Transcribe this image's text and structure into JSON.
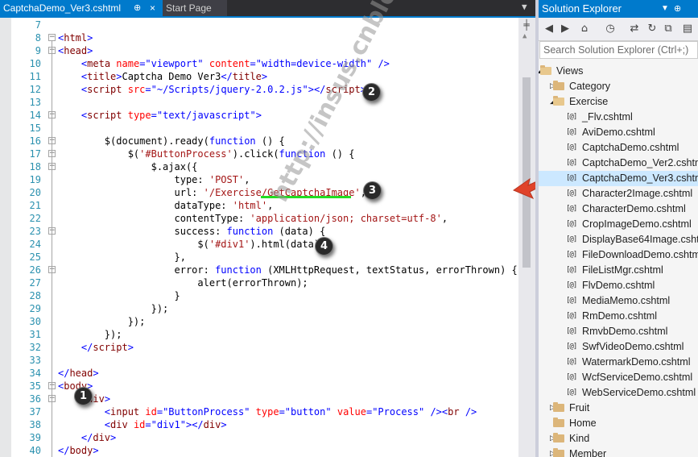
{
  "tabs": {
    "active": "CaptchaDemo_Ver3.cshtml",
    "active_pin": "⊕",
    "active_close": "×",
    "second": "Start Page"
  },
  "code_lines": [
    {
      "n": "7",
      "fold": "",
      "html": ""
    },
    {
      "n": "8",
      "fold": "−",
      "html": "<span class='tk-val'>&lt;</span><span class='tk-tag'>html</span><span class='tk-val'>&gt;</span>"
    },
    {
      "n": "9",
      "fold": "−",
      "html": "<span class='tk-val'>&lt;</span><span class='tk-tag'>head</span><span class='tk-val'>&gt;</span>"
    },
    {
      "n": "10",
      "fold": "",
      "html": "    <span class='tk-val'>&lt;</span><span class='tk-tag'>meta</span> <span class='tk-attr'>name</span><span class='tk-val'>=\"viewport\"</span> <span class='tk-attr'>content</span><span class='tk-val'>=\"width=device-width\"</span> <span class='tk-val'>/&gt;</span>"
    },
    {
      "n": "11",
      "fold": "",
      "html": "    <span class='tk-val'>&lt;</span><span class='tk-tag'>title</span><span class='tk-val'>&gt;</span>Captcha Demo Ver3<span class='tk-val'>&lt;/</span><span class='tk-tag'>title</span><span class='tk-val'>&gt;</span>"
    },
    {
      "n": "12",
      "fold": "",
      "html": "    <span class='tk-val'>&lt;</span><span class='tk-tag'>script</span> <span class='tk-attr'>src</span><span class='tk-val'>=\"~/Scripts/jquery-2.0.2.js\"</span><span class='tk-val'>&gt;&lt;/</span><span class='tk-tag'>script</span><span class='tk-val'>&gt;</span>"
    },
    {
      "n": "13",
      "fold": "",
      "html": ""
    },
    {
      "n": "14",
      "fold": "−",
      "html": "    <span class='tk-val'>&lt;</span><span class='tk-tag'>script</span> <span class='tk-attr'>type</span><span class='tk-val'>=\"text/javascript\"</span><span class='tk-val'>&gt;</span>"
    },
    {
      "n": "15",
      "fold": "",
      "html": ""
    },
    {
      "n": "16",
      "fold": "−",
      "html": "        $(document).ready(<span class='tk-kw'>function</span> () {"
    },
    {
      "n": "17",
      "fold": "−",
      "html": "            $(<span class='tk-str'>'#ButtonProcess'</span>).click(<span class='tk-kw'>function</span> () {"
    },
    {
      "n": "18",
      "fold": "−",
      "html": "                $.ajax({"
    },
    {
      "n": "19",
      "fold": "",
      "html": "                    type: <span class='tk-str'>'POST'</span>,"
    },
    {
      "n": "20",
      "fold": "",
      "html": "                    url: <span class='tk-str'>'/Exercise/GetCaptchaImage'</span>,"
    },
    {
      "n": "21",
      "fold": "",
      "html": "                    dataType: <span class='tk-str'>'html'</span>,"
    },
    {
      "n": "22",
      "fold": "",
      "html": "                    contentType: <span class='tk-str'>'application/json; charset=utf-8'</span>,"
    },
    {
      "n": "23",
      "fold": "−",
      "html": "                    success: <span class='tk-kw'>function</span> (data) {"
    },
    {
      "n": "24",
      "fold": "",
      "html": "                        $(<span class='tk-str'>'#div1'</span>).html(data)"
    },
    {
      "n": "25",
      "fold": "",
      "html": "                    },"
    },
    {
      "n": "26",
      "fold": "−",
      "html": "                    error: <span class='tk-kw'>function</span> (XMLHttpRequest, textStatus, errorThrown) {"
    },
    {
      "n": "27",
      "fold": "",
      "html": "                        alert(errorThrown);"
    },
    {
      "n": "28",
      "fold": "",
      "html": "                    }"
    },
    {
      "n": "29",
      "fold": "",
      "html": "                });"
    },
    {
      "n": "30",
      "fold": "",
      "html": "            });"
    },
    {
      "n": "31",
      "fold": "",
      "html": "        });"
    },
    {
      "n": "32",
      "fold": "",
      "html": "    <span class='tk-val'>&lt;/</span><span class='tk-tag'>script</span><span class='tk-val'>&gt;</span>"
    },
    {
      "n": "33",
      "fold": "",
      "html": ""
    },
    {
      "n": "34",
      "fold": "",
      "html": "<span class='tk-val'>&lt;/</span><span class='tk-tag'>head</span><span class='tk-val'>&gt;</span>"
    },
    {
      "n": "35",
      "fold": "−",
      "html": "<span class='tk-val'>&lt;</span><span class='tk-tag'>body</span><span class='tk-val'>&gt;</span>"
    },
    {
      "n": "36",
      "fold": "−",
      "html": "    <span class='tk-val'>&lt;</span><span class='tk-tag'>div</span><span class='tk-val'>&gt;</span>"
    },
    {
      "n": "37",
      "fold": "",
      "html": "        <span class='tk-val'>&lt;</span><span class='tk-tag'>input</span> <span class='tk-attr'>id</span><span class='tk-val'>=\"ButtonProcess\"</span> <span class='tk-attr'>type</span><span class='tk-val'>=\"button\"</span> <span class='tk-attr'>value</span><span class='tk-val'>=\"Process\"</span> <span class='tk-val'>/&gt;&lt;</span><span class='tk-tag'>br</span> <span class='tk-val'>/&gt;</span>"
    },
    {
      "n": "38",
      "fold": "",
      "html": "        <span class='tk-val'>&lt;</span><span class='tk-tag'>div</span> <span class='tk-attr'>id</span><span class='tk-val'>=\"div1\"</span><span class='tk-val'>&gt;&lt;/</span><span class='tk-tag'>div</span><span class='tk-val'>&gt;</span>"
    },
    {
      "n": "39",
      "fold": "",
      "html": "    <span class='tk-val'>&lt;/</span><span class='tk-tag'>div</span><span class='tk-val'>&gt;</span>"
    },
    {
      "n": "40",
      "fold": "",
      "html": "<span class='tk-val'>&lt;/</span><span class='tk-tag'>body</span><span class='tk-val'>&gt;</span>"
    }
  ],
  "badges": [
    "1",
    "2",
    "3",
    "4"
  ],
  "watermark": "http://insus.cnblogs.com",
  "solution_explorer": {
    "title": "Solution Explorer",
    "title_dropdown": "▼",
    "title_pin": "⊕",
    "search_placeholder": "Search Solution Explorer (Ctrl+;)",
    "toolbar_icons": [
      "back-icon",
      "forward-icon",
      "home-icon",
      "history-icon",
      "sync-icon",
      "refresh-icon",
      "collapse-all-icon",
      "show-all-files-icon"
    ],
    "toolbar_glyphs": [
      "◀",
      "▶",
      "⌂",
      "◷",
      "⇄",
      "↻",
      "⧉",
      "▤"
    ],
    "tree": [
      {
        "label": "Views",
        "kind": "open-folder",
        "depth": 0,
        "expand": "◢"
      },
      {
        "label": "Category",
        "kind": "folder",
        "depth": 1,
        "expand": "▷"
      },
      {
        "label": "Exercise",
        "kind": "open-folder",
        "depth": 1,
        "expand": "◢"
      },
      {
        "label": "_Flv.cshtml",
        "kind": "file",
        "depth": 2
      },
      {
        "label": "AviDemo.cshtml",
        "kind": "file",
        "depth": 2
      },
      {
        "label": "CaptchaDemo.cshtml",
        "kind": "file",
        "depth": 2
      },
      {
        "label": "CaptchaDemo_Ver2.cshtml",
        "kind": "file",
        "depth": 2
      },
      {
        "label": "CaptchaDemo_Ver3.cshtml",
        "kind": "file",
        "depth": 2,
        "selected": true
      },
      {
        "label": "Character2Image.cshtml",
        "kind": "file",
        "depth": 2
      },
      {
        "label": "CharacterDemo.cshtml",
        "kind": "file",
        "depth": 2
      },
      {
        "label": "CropImageDemo.cshtml",
        "kind": "file",
        "depth": 2
      },
      {
        "label": "DisplayBase64Image.cshtml",
        "kind": "file",
        "depth": 2
      },
      {
        "label": "FileDownloadDemo.cshtml",
        "kind": "file",
        "depth": 2
      },
      {
        "label": "FileListMgr.cshtml",
        "kind": "file",
        "depth": 2
      },
      {
        "label": "FlvDemo.cshtml",
        "kind": "file",
        "depth": 2
      },
      {
        "label": "MediaMemo.cshtml",
        "kind": "file",
        "depth": 2
      },
      {
        "label": "RmDemo.cshtml",
        "kind": "file",
        "depth": 2
      },
      {
        "label": "RmvbDemo.cshtml",
        "kind": "file",
        "depth": 2
      },
      {
        "label": "SwfVideoDemo.cshtml",
        "kind": "file",
        "depth": 2
      },
      {
        "label": "WatermarkDemo.cshtml",
        "kind": "file",
        "depth": 2
      },
      {
        "label": "WcfServiceDemo.cshtml",
        "kind": "file",
        "depth": 2
      },
      {
        "label": "WebServiceDemo.cshtml",
        "kind": "file",
        "depth": 2
      },
      {
        "label": "Fruit",
        "kind": "folder",
        "depth": 1,
        "expand": "▷"
      },
      {
        "label": "Home",
        "kind": "folder",
        "depth": 1,
        "expand": ""
      },
      {
        "label": "Kind",
        "kind": "folder",
        "depth": 1,
        "expand": "▷"
      },
      {
        "label": "Member",
        "kind": "folder",
        "depth": 1,
        "expand": "▷"
      }
    ],
    "file_icon_text": "[@]"
  },
  "colors": {
    "accent": "#007acc",
    "selection": "#cce8ff",
    "arrow": "#e0432a",
    "highlight_underline": "#22dd22"
  }
}
